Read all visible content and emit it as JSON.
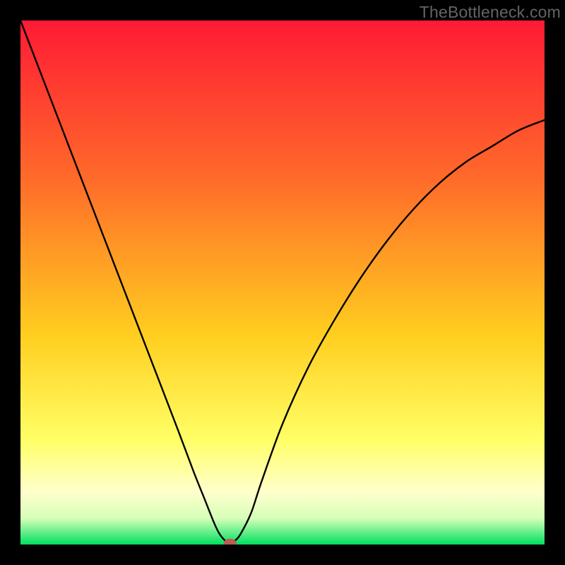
{
  "watermark": "TheBottleneck.com",
  "colors": {
    "gradient_top": "#ff1a35",
    "gradient_mid1": "#ff6a2a",
    "gradient_mid2": "#ffce1f",
    "gradient_mid3": "#ffff66",
    "gradient_mid4": "#ffffcc",
    "gradient_mid5": "#d6ffb8",
    "gradient_bot": "#00e060",
    "curve": "#000000",
    "marker": "#c05a54",
    "frame": "#000000"
  },
  "chart_data": {
    "type": "line",
    "title": "",
    "xlabel": "",
    "ylabel": "",
    "xlim": [
      0,
      100
    ],
    "ylim": [
      0,
      100
    ],
    "series": [
      {
        "name": "bottleneck-curve",
        "x": [
          0,
          5,
          10,
          15,
          20,
          25,
          30,
          33,
          35,
          37,
          38,
          39,
          40,
          41,
          42,
          44,
          46,
          50,
          55,
          60,
          65,
          70,
          75,
          80,
          85,
          90,
          95,
          100
        ],
        "values": [
          100,
          87,
          74,
          61,
          48,
          35,
          22,
          14,
          9,
          4,
          2,
          0.8,
          0.3,
          0.8,
          2,
          6,
          12,
          23,
          34,
          43,
          51,
          58,
          64,
          69,
          73,
          76,
          79,
          81
        ]
      }
    ],
    "marker": {
      "x": 40,
      "y": 0.3,
      "color": "#c05a54"
    },
    "background_gradient": {
      "stops": [
        {
          "pos": 0.0,
          "color": "#ff1a35"
        },
        {
          "pos": 0.3,
          "color": "#ff6a2a"
        },
        {
          "pos": 0.6,
          "color": "#ffce1f"
        },
        {
          "pos": 0.8,
          "color": "#ffff66"
        },
        {
          "pos": 0.9,
          "color": "#ffffcc"
        },
        {
          "pos": 0.95,
          "color": "#d6ffb8"
        },
        {
          "pos": 1.0,
          "color": "#00e060"
        }
      ]
    }
  }
}
